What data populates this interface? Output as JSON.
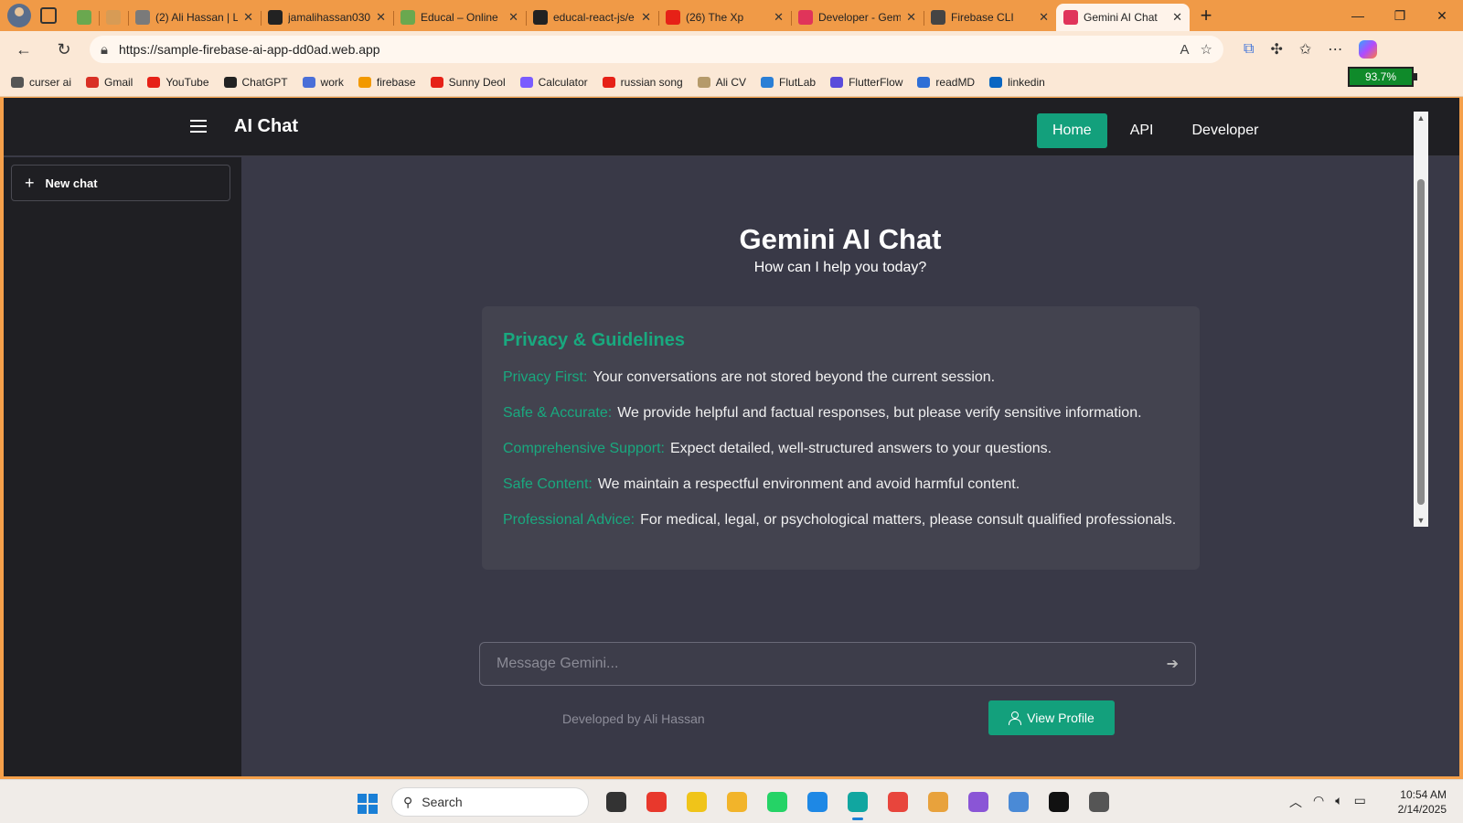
{
  "browser": {
    "tabs": [
      {
        "label": "",
        "favicon": "green-app-icon",
        "color": "#6aa84f",
        "pinned": true
      },
      {
        "label": "",
        "favicon": "ring-icon",
        "color": "#d79b55",
        "pinned": true
      },
      {
        "label": "(2) Ali Hassan | L",
        "favicon": "linkedin-icon",
        "color": "#7a7a7a"
      },
      {
        "label": "jamalihassan030",
        "favicon": "github-icon",
        "color": "#222222"
      },
      {
        "label": "Educal – Online",
        "favicon": "educal-icon",
        "color": "#6aa84f"
      },
      {
        "label": "educal-react-js/e",
        "favicon": "github-icon",
        "color": "#222222"
      },
      {
        "label": "(26) The Xp",
        "favicon": "youtube-icon",
        "color": "#e62117"
      },
      {
        "label": "Developer - Gem",
        "favicon": "angular-icon",
        "color": "#e0345a"
      },
      {
        "label": "Firebase CLI",
        "favicon": "globe-icon",
        "color": "#444444"
      },
      {
        "label": "Gemini AI Chat",
        "favicon": "angular-icon",
        "color": "#e0345a",
        "active": true
      }
    ],
    "url": "https://sample-firebase-ai-app-dd0ad.web.app",
    "bookmarks": [
      {
        "label": "curser ai",
        "color": "#555555"
      },
      {
        "label": "Gmail",
        "color": "#d93025"
      },
      {
        "label": "YouTube",
        "color": "#e62117"
      },
      {
        "label": "ChatGPT",
        "color": "#222222"
      },
      {
        "label": "work",
        "color": "#4a6fd8"
      },
      {
        "label": "firebase",
        "color": "#f29900"
      },
      {
        "label": "Sunny Deol",
        "color": "#e62117"
      },
      {
        "label": "Calculator",
        "color": "#7a5cff"
      },
      {
        "label": "russian song",
        "color": "#e62117"
      },
      {
        "label": "Ali CV",
        "color": "#b59a6a"
      },
      {
        "label": "FlutLab",
        "color": "#2a7fd6"
      },
      {
        "label": "FlutterFlow",
        "color": "#5a4bdb"
      },
      {
        "label": "readMD",
        "color": "#2f6fd6"
      },
      {
        "label": "linkedin",
        "color": "#0a66c2"
      }
    ],
    "battery": "93.7%"
  },
  "app": {
    "brand": "AI Chat",
    "nav": [
      {
        "label": "Home",
        "active": true
      },
      {
        "label": "API"
      },
      {
        "label": "Developer"
      }
    ],
    "sidebar": {
      "new_chat": "New chat"
    },
    "title": "Gemini AI Chat",
    "subtitle": "How can I help you today?",
    "guidelines": {
      "heading": "Privacy & Guidelines",
      "items": [
        {
          "key": "Privacy First:",
          "text": "Your conversations are not stored beyond the current session."
        },
        {
          "key": "Safe & Accurate:",
          "text": "We provide helpful and factual responses, but please verify sensitive information."
        },
        {
          "key": "Comprehensive Support:",
          "text": "Expect detailed, well-structured answers to your questions."
        },
        {
          "key": "Safe Content:",
          "text": "We maintain a respectful environment and avoid harmful content."
        },
        {
          "key": "Professional Advice:",
          "text": "For medical, legal, or psychological matters, please consult qualified professionals."
        }
      ]
    },
    "input_placeholder": "Message Gemini...",
    "credit": "Developed by Ali Hassan",
    "profile_button": "View Profile",
    "accent": "#13a07c"
  },
  "taskbar": {
    "search_label": "Search",
    "apps": [
      {
        "name": "task-view-icon",
        "color": "#333333"
      },
      {
        "name": "anydesk-icon",
        "color": "#e8382c"
      },
      {
        "name": "pb-icon",
        "color": "#f0c419"
      },
      {
        "name": "file-explorer-icon",
        "color": "#f2b42a"
      },
      {
        "name": "whatsapp-icon",
        "color": "#25d366"
      },
      {
        "name": "vscode-icon",
        "color": "#1e88e5"
      },
      {
        "name": "edge-icon",
        "color": "#11a6a0",
        "active": true
      },
      {
        "name": "chrome-icon",
        "color": "#e8453c"
      },
      {
        "name": "chrome-dev-icon",
        "color": "#e8a23c"
      },
      {
        "name": "visual-studio-icon",
        "color": "#8a55d6"
      },
      {
        "name": "photos-icon",
        "color": "#4a8ad6"
      },
      {
        "name": "capcut-icon",
        "color": "#111111"
      },
      {
        "name": "yandex-icon",
        "color": "#555555"
      }
    ],
    "time": "10:54 AM",
    "date": "2/14/2025"
  }
}
